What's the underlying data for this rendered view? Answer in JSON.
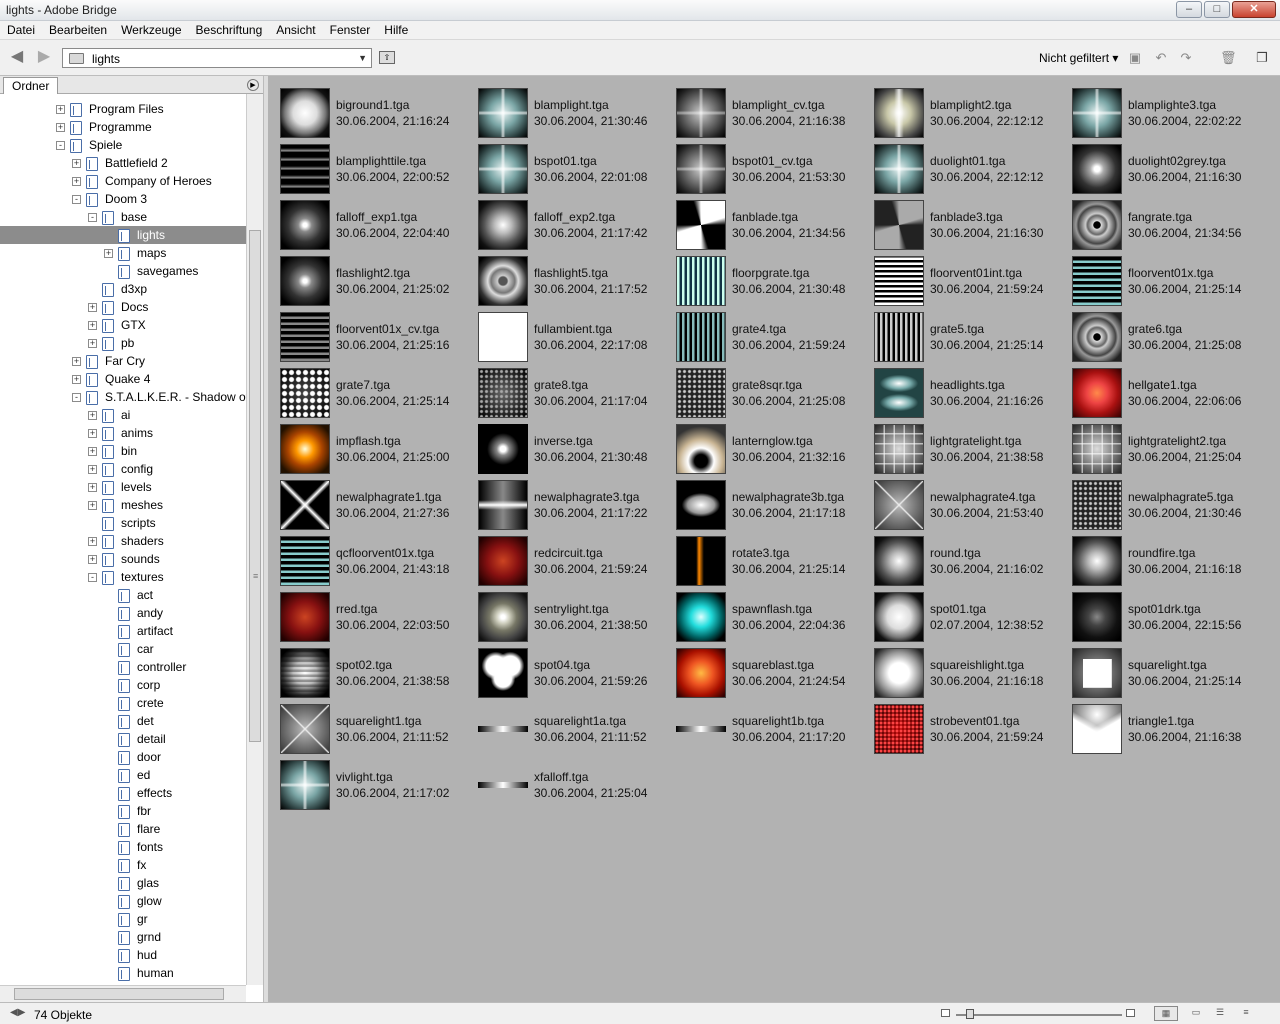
{
  "window": {
    "title": "lights - Adobe Bridge",
    "buttons": [
      "‒",
      "□",
      "✕"
    ]
  },
  "menu": [
    "Datei",
    "Bearbeiten",
    "Werkzeuge",
    "Beschriftung",
    "Ansicht",
    "Fenster",
    "Hilfe"
  ],
  "toolbar": {
    "path": "lights",
    "filter": "Nicht gefiltert ▾"
  },
  "panel": {
    "tab": "Ordner"
  },
  "tree": [
    {
      "label": "Program Files",
      "level": 1,
      "exp": "+",
      "sel": false
    },
    {
      "label": "Programme",
      "level": 1,
      "exp": "+",
      "sel": false
    },
    {
      "label": "Spiele",
      "level": 1,
      "exp": "-",
      "sel": false
    },
    {
      "label": "Battlefield 2",
      "level": 2,
      "exp": "+",
      "sel": false
    },
    {
      "label": "Company of Heroes",
      "level": 2,
      "exp": "+",
      "sel": false
    },
    {
      "label": "Doom 3",
      "level": 2,
      "exp": "-",
      "sel": false
    },
    {
      "label": "base",
      "level": 3,
      "exp": "-",
      "sel": false
    },
    {
      "label": "lights",
      "level": 4,
      "exp": "",
      "sel": true
    },
    {
      "label": "maps",
      "level": 4,
      "exp": "+",
      "sel": false
    },
    {
      "label": "savegames",
      "level": 4,
      "exp": "",
      "sel": false
    },
    {
      "label": "d3xp",
      "level": 3,
      "exp": "",
      "sel": false
    },
    {
      "label": "Docs",
      "level": 3,
      "exp": "+",
      "sel": false
    },
    {
      "label": "GTX",
      "level": 3,
      "exp": "+",
      "sel": false
    },
    {
      "label": "pb",
      "level": 3,
      "exp": "+",
      "sel": false
    },
    {
      "label": "Far Cry",
      "level": 2,
      "exp": "+",
      "sel": false
    },
    {
      "label": "Quake 4",
      "level": 2,
      "exp": "+",
      "sel": false
    },
    {
      "label": "S.T.A.L.K.E.R. - Shadow of C",
      "level": 2,
      "exp": "-",
      "sel": false
    },
    {
      "label": "ai",
      "level": 3,
      "exp": "+",
      "sel": false
    },
    {
      "label": "anims",
      "level": 3,
      "exp": "+",
      "sel": false
    },
    {
      "label": "bin",
      "level": 3,
      "exp": "+",
      "sel": false
    },
    {
      "label": "config",
      "level": 3,
      "exp": "+",
      "sel": false
    },
    {
      "label": "levels",
      "level": 3,
      "exp": "+",
      "sel": false
    },
    {
      "label": "meshes",
      "level": 3,
      "exp": "+",
      "sel": false
    },
    {
      "label": "scripts",
      "level": 3,
      "exp": "",
      "sel": false
    },
    {
      "label": "shaders",
      "level": 3,
      "exp": "+",
      "sel": false
    },
    {
      "label": "sounds",
      "level": 3,
      "exp": "+",
      "sel": false
    },
    {
      "label": "textures",
      "level": 3,
      "exp": "-",
      "sel": false
    },
    {
      "label": "act",
      "level": 4,
      "exp": "",
      "sel": false
    },
    {
      "label": "andy",
      "level": 4,
      "exp": "",
      "sel": false
    },
    {
      "label": "artifact",
      "level": 4,
      "exp": "",
      "sel": false
    },
    {
      "label": "car",
      "level": 4,
      "exp": "",
      "sel": false
    },
    {
      "label": "controller",
      "level": 4,
      "exp": "",
      "sel": false
    },
    {
      "label": "corp",
      "level": 4,
      "exp": "",
      "sel": false
    },
    {
      "label": "crete",
      "level": 4,
      "exp": "",
      "sel": false
    },
    {
      "label": "det",
      "level": 4,
      "exp": "",
      "sel": false
    },
    {
      "label": "detail",
      "level": 4,
      "exp": "",
      "sel": false
    },
    {
      "label": "door",
      "level": 4,
      "exp": "",
      "sel": false
    },
    {
      "label": "ed",
      "level": 4,
      "exp": "",
      "sel": false
    },
    {
      "label": "effects",
      "level": 4,
      "exp": "",
      "sel": false
    },
    {
      "label": "fbr",
      "level": 4,
      "exp": "",
      "sel": false
    },
    {
      "label": "flare",
      "level": 4,
      "exp": "",
      "sel": false
    },
    {
      "label": "fonts",
      "level": 4,
      "exp": "",
      "sel": false
    },
    {
      "label": "fx",
      "level": 4,
      "exp": "",
      "sel": false
    },
    {
      "label": "glas",
      "level": 4,
      "exp": "",
      "sel": false
    },
    {
      "label": "glow",
      "level": 4,
      "exp": "",
      "sel": false
    },
    {
      "label": "gr",
      "level": 4,
      "exp": "",
      "sel": false
    },
    {
      "label": "grnd",
      "level": 4,
      "exp": "",
      "sel": false
    },
    {
      "label": "hud",
      "level": 4,
      "exp": "",
      "sel": false
    },
    {
      "label": "human",
      "level": 4,
      "exp": "",
      "sel": false
    }
  ],
  "items": [
    {
      "name": "biground1.tga",
      "date": "30.06.2004, 21:16:24",
      "style": "radial"
    },
    {
      "name": "blamplight.tga",
      "date": "30.06.2004, 21:30:46",
      "style": "cross-teal"
    },
    {
      "name": "blamplight_cv.tga",
      "date": "30.06.2004, 21:16:38",
      "style": "cross-grey"
    },
    {
      "name": "blamplight2.tga",
      "date": "30.06.2004, 22:12:12",
      "style": "cross-warm"
    },
    {
      "name": "blamplighte3.tga",
      "date": "30.06.2004, 22:02:22",
      "style": "cross-teal"
    },
    {
      "name": "blamplighttile.tga",
      "date": "30.06.2004, 22:00:52",
      "style": "stripes"
    },
    {
      "name": "bspot01.tga",
      "date": "30.06.2004, 22:01:08",
      "style": "cross-teal"
    },
    {
      "name": "bspot01_cv.tga",
      "date": "30.06.2004, 21:53:30",
      "style": "cross-grey"
    },
    {
      "name": "duolight01.tga",
      "date": "30.06.2004, 22:12:12",
      "style": "cross-teal"
    },
    {
      "name": "duolight02grey.tga",
      "date": "30.06.2004, 21:16:30",
      "style": "star"
    },
    {
      "name": "falloff_exp1.tga",
      "date": "30.06.2004, 22:04:40",
      "style": "spot"
    },
    {
      "name": "falloff_exp2.tga",
      "date": "30.06.2004, 21:17:42",
      "style": "radial-soft"
    },
    {
      "name": "fanblade.tga",
      "date": "30.06.2004, 21:34:56",
      "style": "fan"
    },
    {
      "name": "fanblade3.tga",
      "date": "30.06.2004, 21:16:30",
      "style": "fan-grey"
    },
    {
      "name": "fangrate.tga",
      "date": "30.06.2004, 21:34:56",
      "style": "grate-ring"
    },
    {
      "name": "flashlight2.tga",
      "date": "30.06.2004, 21:25:02",
      "style": "spot"
    },
    {
      "name": "flashlight5.tga",
      "date": "30.06.2004, 21:17:52",
      "style": "ring"
    },
    {
      "name": "floorpgrate.tga",
      "date": "30.06.2004, 21:30:48",
      "style": "floor"
    },
    {
      "name": "floorvent01int.tga",
      "date": "30.06.2004, 21:59:24",
      "style": "vent"
    },
    {
      "name": "floorvent01x.tga",
      "date": "30.06.2004, 21:25:14",
      "style": "vent-teal"
    },
    {
      "name": "floorvent01x_cv.tga",
      "date": "30.06.2004, 21:25:16",
      "style": "vent-dark"
    },
    {
      "name": "fullambient.tga",
      "date": "30.06.2004, 22:17:08",
      "style": "white"
    },
    {
      "name": "grate4.tga",
      "date": "30.06.2004, 21:59:24",
      "style": "vstripes-teal"
    },
    {
      "name": "grate5.tga",
      "date": "30.06.2004, 21:25:14",
      "style": "vstripes"
    },
    {
      "name": "grate6.tga",
      "date": "30.06.2004, 21:25:08",
      "style": "grate-ring"
    },
    {
      "name": "grate7.tga",
      "date": "30.06.2004, 21:25:14",
      "style": "dots"
    },
    {
      "name": "grate8.tga",
      "date": "30.06.2004, 21:17:04",
      "style": "dots-soft"
    },
    {
      "name": "grate8sqr.tga",
      "date": "30.06.2004, 21:25:08",
      "style": "dots-grid"
    },
    {
      "name": "headlights.tga",
      "date": "30.06.2004, 21:16:26",
      "style": "headlights"
    },
    {
      "name": "hellgate1.tga",
      "date": "30.06.2004, 22:06:06",
      "style": "red-fire"
    },
    {
      "name": "impflash.tga",
      "date": "30.06.2004, 21:25:00",
      "style": "orange"
    },
    {
      "name": "inverse.tga",
      "date": "30.06.2004, 21:30:48",
      "style": "inverse"
    },
    {
      "name": "lanternglow.tga",
      "date": "30.06.2004, 21:32:16",
      "style": "lantern"
    },
    {
      "name": "lightgratelight.tga",
      "date": "30.06.2004, 21:38:58",
      "style": "cross-grid"
    },
    {
      "name": "lightgratelight2.tga",
      "date": "30.06.2004, 21:25:04",
      "style": "cross-grid"
    },
    {
      "name": "newalphagrate1.tga",
      "date": "30.06.2004, 21:27:36",
      "style": "xgrate"
    },
    {
      "name": "newalphagrate3.tga",
      "date": "30.06.2004, 21:17:22",
      "style": "bar-wide"
    },
    {
      "name": "newalphagrate3b.tga",
      "date": "30.06.2004, 21:17:18",
      "style": "bar-soft"
    },
    {
      "name": "newalphagrate4.tga",
      "date": "30.06.2004, 21:53:40",
      "style": "square-x"
    },
    {
      "name": "newalphagrate5.tga",
      "date": "30.06.2004, 21:30:46",
      "style": "dots-grid"
    },
    {
      "name": "qcfloorvent01x.tga",
      "date": "30.06.2004, 21:43:18",
      "style": "vent-teal"
    },
    {
      "name": "redcircuit.tga",
      "date": "30.06.2004, 21:59:24",
      "style": "red-dark"
    },
    {
      "name": "rotate3.tga",
      "date": "30.06.2004, 21:25:14",
      "style": "rotate"
    },
    {
      "name": "round.tga",
      "date": "30.06.2004, 21:16:02",
      "style": "radial-soft"
    },
    {
      "name": "roundfire.tga",
      "date": "30.06.2004, 21:16:18",
      "style": "radial-soft"
    },
    {
      "name": "rred.tga",
      "date": "30.06.2004, 22:03:50",
      "style": "red-dark"
    },
    {
      "name": "sentrylight.tga",
      "date": "30.06.2004, 21:38:50",
      "style": "sentry"
    },
    {
      "name": "spawnflash.tga",
      "date": "30.06.2004, 22:04:36",
      "style": "cyan"
    },
    {
      "name": "spot01.tga",
      "date": "02.07.2004, 12:38:52",
      "style": "radial"
    },
    {
      "name": "spot01drk.tga",
      "date": "30.06.2004, 22:15:56",
      "style": "dark-star"
    },
    {
      "name": "spot02.tga",
      "date": "30.06.2004, 21:38:58",
      "style": "hstripes-ball"
    },
    {
      "name": "spot04.tga",
      "date": "30.06.2004, 21:59:26",
      "style": "trefoil"
    },
    {
      "name": "squareblast.tga",
      "date": "30.06.2004, 21:24:54",
      "style": "orange-red"
    },
    {
      "name": "squareishlight.tga",
      "date": "30.06.2004, 21:16:18",
      "style": "square-soft"
    },
    {
      "name": "squarelight.tga",
      "date": "30.06.2004, 21:25:14",
      "style": "square-bright"
    },
    {
      "name": "squarelight1.tga",
      "date": "30.06.2004, 21:11:52",
      "style": "square-x"
    },
    {
      "name": "squarelight1a.tga",
      "date": "30.06.2004, 21:11:52",
      "style": "thin-bar"
    },
    {
      "name": "squarelight1b.tga",
      "date": "30.06.2004, 21:17:20",
      "style": "thin-bar"
    },
    {
      "name": "strobevent01.tga",
      "date": "30.06.2004, 21:59:24",
      "style": "red-dots"
    },
    {
      "name": "triangle1.tga",
      "date": "30.06.2004, 21:16:38",
      "style": "triangle"
    },
    {
      "name": "vivlight.tga",
      "date": "30.06.2004, 21:17:02",
      "style": "cross-teal"
    },
    {
      "name": "xfalloff.tga",
      "date": "30.06.2004, 21:25:04",
      "style": "thin-bar"
    }
  ],
  "status": {
    "count": "74 Objekte"
  }
}
